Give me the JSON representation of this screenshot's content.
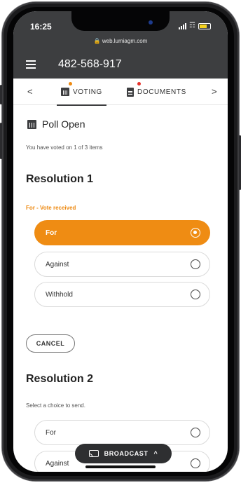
{
  "status_bar": {
    "time": "16:25",
    "url": "web.lumiagm.com"
  },
  "app_bar": {
    "meeting_id": "482-568-917"
  },
  "tabs": {
    "prev_glyph": "<",
    "next_glyph": ">",
    "items": [
      {
        "label": "VOTING",
        "icon": "bar-chart-icon",
        "active": true,
        "dot_color": "#ee8a12"
      },
      {
        "label": "DOCUMENTS",
        "icon": "document-icon",
        "active": false,
        "dot_color": "#e6322b"
      }
    ]
  },
  "poll": {
    "title": "Poll Open",
    "progress_text": "You have voted on 1 of 3 items",
    "voted_count": 1,
    "total_items": 3
  },
  "resolution_1": {
    "title": "Resolution 1",
    "status": "For - Vote received",
    "options": [
      {
        "label": "For",
        "selected": true
      },
      {
        "label": "Against",
        "selected": false
      },
      {
        "label": "Withhold",
        "selected": false
      }
    ],
    "cancel_label": "CANCEL"
  },
  "resolution_2": {
    "title": "Resolution 2",
    "instruction": "Select a choice to send.",
    "options": [
      {
        "label": "For",
        "selected": false
      },
      {
        "label": "Against",
        "selected": false
      }
    ]
  },
  "broadcast": {
    "label": "BROADCAST",
    "chevron": "^"
  },
  "colors": {
    "accent": "#ef8c13",
    "header": "#3d3e40"
  }
}
